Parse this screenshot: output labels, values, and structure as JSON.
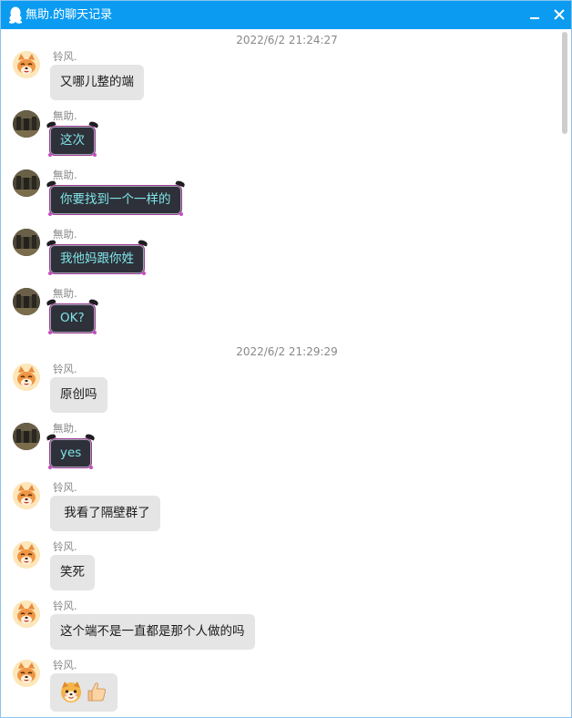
{
  "window": {
    "title": "無助.的聊天记录",
    "accent_color": "#0b9cf2"
  },
  "titlebar_buttons": {
    "minimize_icon": "minimize-icon",
    "close_icon": "close-icon"
  },
  "timestamps": [
    "2022/6/2 21:24:27",
    "2022/6/2 21:29:29"
  ],
  "messages": [
    {
      "sender": "铃风.",
      "avatar": "fox-avatar",
      "text": "又哪儿整的端"
    },
    {
      "sender": "無助.",
      "avatar": "dark-avatar",
      "text": "这次"
    },
    {
      "sender": "無助.",
      "avatar": "dark-avatar",
      "text": "你要找到一个一样的"
    },
    {
      "sender": "無助.",
      "avatar": "dark-avatar",
      "text": "我他妈跟你姓"
    },
    {
      "sender": "無助.",
      "avatar": "dark-avatar",
      "text": "OK?"
    },
    {
      "sender": "铃风.",
      "avatar": "fox-avatar",
      "text": "原创吗"
    },
    {
      "sender": "無助.",
      "avatar": "dark-avatar",
      "text": "yes"
    },
    {
      "sender": "铃风.",
      "avatar": "fox-avatar",
      "text": " 我看了隔壁群了"
    },
    {
      "sender": "铃风.",
      "avatar": "fox-avatar",
      "text": "笑死"
    },
    {
      "sender": "铃风.",
      "avatar": "fox-avatar",
      "text": "这个端不是一直都是那个人做的吗"
    },
    {
      "sender": "铃风.",
      "avatar": "fox-avatar",
      "text": "",
      "emojis": [
        "shiba-emoji",
        "thumbs-up-emoji"
      ]
    }
  ]
}
